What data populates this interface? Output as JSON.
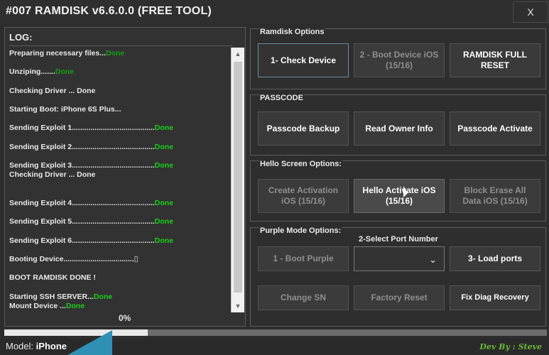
{
  "window": {
    "title": "#007 RAMDISK v6.6.0.0 (FREE TOOL)",
    "close_label": "X"
  },
  "log": {
    "title": "LOG:",
    "lines": [
      {
        "text": "Preparing necessary files...",
        "status": "Done"
      },
      {
        "text": "Unziping.......",
        "status": "Done"
      },
      {
        "text": "Checking Driver  ... Done",
        "status": ""
      },
      {
        "text": "Starting  Boot: iPhone 6S Plus...",
        "status": ""
      },
      {
        "text": "Sending Exploit 1........................................",
        "status": "Done"
      },
      {
        "text": "Sending Exploit 2........................................",
        "status": "Done"
      },
      {
        "text": "Sending Exploit 3........................................",
        "status": "Done"
      },
      {
        "text": "Checking Driver  ... Done",
        "status": ""
      },
      {
        "text": "Sending Exploit 4........................................",
        "status": "Done"
      },
      {
        "text": "Sending Exploit 5........................................",
        "status": "Done"
      },
      {
        "text": "Sending Exploit 6........................................",
        "status": "Done"
      },
      {
        "text": "Booting Device..................................▯",
        "status": ""
      },
      {
        "text": "BOOT RAMDISK DONE !",
        "status": ""
      },
      {
        "text": " Starting SSH SERVER...",
        "status": "Done"
      },
      {
        "text": "Mount Device ...",
        "status": "Done"
      }
    ],
    "percent": "0%"
  },
  "progress": {
    "fraction": 0.265
  },
  "status_bar": {
    "model_prefix": "Model:",
    "model_value": "iPhone",
    "dev_by": "Dev By : Steve"
  },
  "ramdisk_options": {
    "title": "Ramdisk Options",
    "check_device": "1- Check Device",
    "boot_device": "2 - Boot Device iOS\n(15/16)",
    "full_reset": "RAMDISK FULL\nRESET"
  },
  "passcode": {
    "title": "PASSCODE",
    "backup": "Passcode Backup",
    "read_owner": "Read Owner Info",
    "activate": "Passcode Activate"
  },
  "hello_screen": {
    "title": "Hello Screen Options:",
    "create_activation": "Create Activation\niOS (15/16)",
    "hello_activate": "Hello Activate iOS\n(15/16)",
    "block_erase": "Block Erase All\nData iOS (15/16)"
  },
  "purple_mode": {
    "title": "Purple Mode Options:",
    "port_label": "2-Select Port Number",
    "port_value": "",
    "boot_purple": "1 - Boot Purple",
    "load_ports": "3- Load ports",
    "change_sn": "Change SN",
    "factory_reset": "Factory Reset",
    "fix_diag": "Fix Diag Recovery"
  },
  "colors": {
    "background": "#2d2d2d",
    "done_green": "#18d11a",
    "accent_blue": "#2f8fb5",
    "dev_green": "#6ab63a"
  }
}
